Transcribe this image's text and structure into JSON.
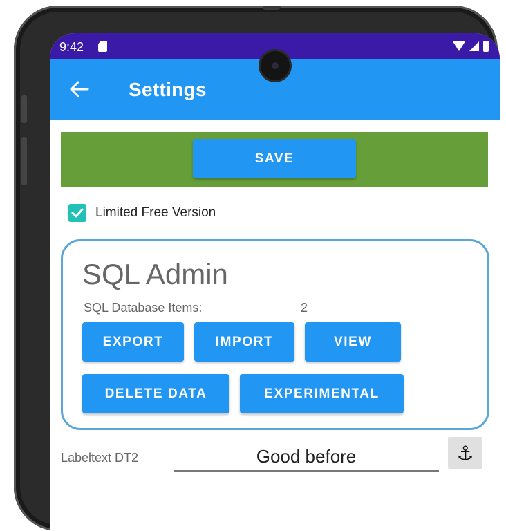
{
  "status_bar": {
    "time": "9:42"
  },
  "app_bar": {
    "title": "Settings"
  },
  "save_button": {
    "label": "SAVE"
  },
  "limited_free_version": {
    "checked": true,
    "label": "Limited Free Version"
  },
  "sql_admin": {
    "title": "SQL Admin",
    "items_label": "SQL Database Items:",
    "items_count": "2",
    "buttons": {
      "export": "EXPORT",
      "import": "IMPORT",
      "view": "VIEW",
      "delete_data": "DELETE DATA",
      "experimental": "EXPERIMENTAL"
    }
  },
  "labeltext_field": {
    "label": "Labeltext DT2",
    "value": "Good before"
  },
  "icons": {
    "back": "arrow-left",
    "anchor": "anchor",
    "checkbox": "check"
  },
  "colors": {
    "status_bar": "#3b1aa8",
    "app_bar": "#2196f3",
    "save_panel": "#669e3a",
    "button": "#2196f3",
    "checkbox": "#22c1b7",
    "card_border": "#5aa6d6"
  }
}
